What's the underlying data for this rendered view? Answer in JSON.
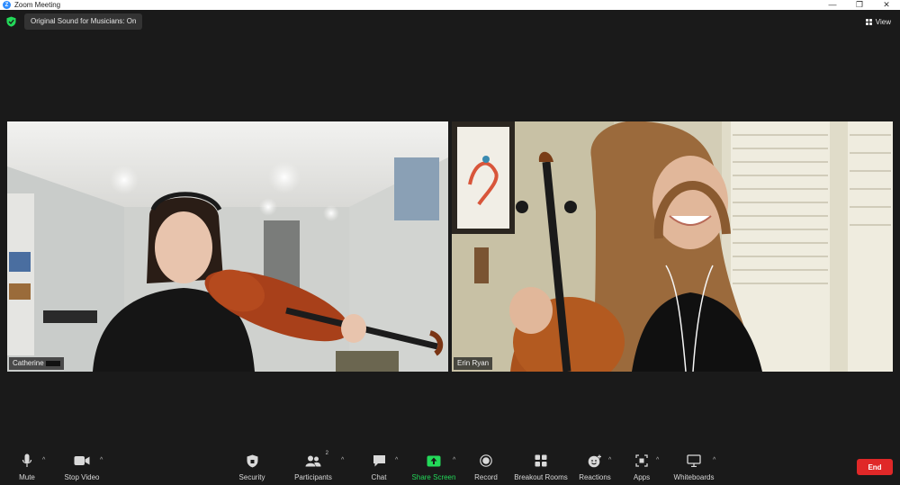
{
  "window": {
    "title": "Zoom Meeting",
    "app_icon_glyph": "Z",
    "controls": {
      "minimize": "—",
      "restore": "❐",
      "close": "✕"
    }
  },
  "top_bar": {
    "sound_label": "Original Sound for Musicians: On",
    "view_label": "View",
    "shield_color": "#23d959"
  },
  "participants": [
    {
      "name": "Catherine",
      "name_redacted": true
    },
    {
      "name": "Erin Ryan",
      "name_redacted": false
    }
  ],
  "toolbar": {
    "mute": "Mute",
    "stop_video": "Stop Video",
    "security": "Security",
    "participants": "Participants",
    "participants_count": "2",
    "chat": "Chat",
    "share_screen": "Share Screen",
    "record": "Record",
    "breakout_rooms": "Breakout Rooms",
    "reactions": "Reactions",
    "apps": "Apps",
    "whiteboards": "Whiteboards",
    "end": "End",
    "caret_glyph": "^",
    "accent_green": "#23d959",
    "end_color": "#e02828"
  }
}
